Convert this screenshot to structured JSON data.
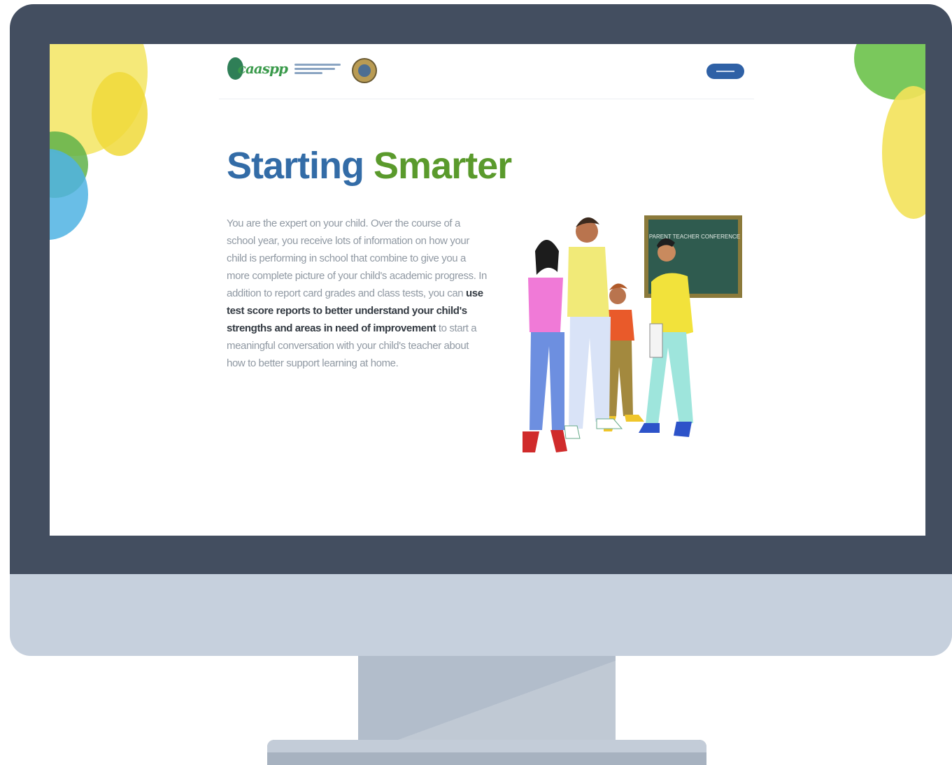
{
  "header": {
    "logo_text": "caaspp",
    "icons": {
      "logo": "caaspp-logo-icon",
      "seal": "state-seal-icon",
      "button": "header-button"
    }
  },
  "hero": {
    "title_part1": "Starting",
    "title_part2": "Smarter",
    "copy_intro": "You are the expert on your child. Over the course of a school year, you receive lots of information on how your child is performing in school that combine to give you a more complete picture of your child's academic progress. In addition to report card grades and class tests, you can ",
    "copy_bold": "use test score reports to better understand your child's strengths and areas in need of improvement",
    "copy_outro": " to start a meaningful conversation with your child's teacher about how to better support learning at home."
  },
  "illustration": {
    "chalkboard_text": "PARENT TEACHER CONFERENCE"
  },
  "colors": {
    "bezel": "#434e60",
    "chin": "#c6d0dd",
    "title_blue": "#336ca7",
    "title_green": "#5a9a2c",
    "button_blue": "#2f61a6"
  }
}
